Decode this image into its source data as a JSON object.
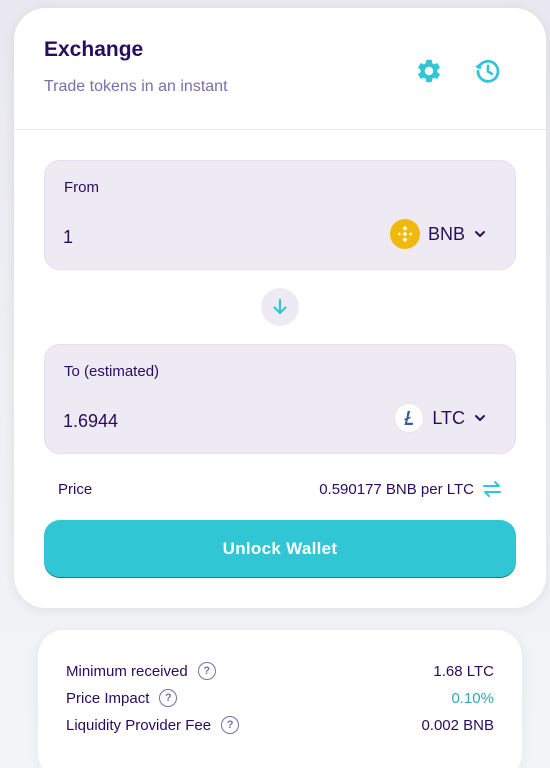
{
  "header": {
    "title": "Exchange",
    "subtitle": "Trade tokens in an instant",
    "settings_icon": "gear-icon",
    "history_icon": "history-icon"
  },
  "from": {
    "label": "From",
    "amount": "1",
    "token": "BNB",
    "token_icon": "bnb-logo-icon"
  },
  "to": {
    "label": "To (estimated)",
    "amount": "1.6944",
    "token": "LTC",
    "token_icon": "ltc-logo-icon"
  },
  "swap_icon": "arrow-down-icon",
  "price": {
    "label": "Price",
    "value": "0.590177 BNB per LTC",
    "switch_icon": "swap-arrows-icon"
  },
  "action": {
    "label": "Unlock Wallet"
  },
  "details": {
    "minimum_received": {
      "label": "Minimum received",
      "value": "1.68 LTC"
    },
    "price_impact": {
      "label": "Price Impact",
      "value": "0.10%"
    },
    "lp_fee": {
      "label": "Liquidity Provider Fee",
      "value": "0.002 BNB"
    }
  },
  "colors": {
    "primary": "#31c6d3",
    "text": "#280d5f",
    "subtext": "#7a6eaa",
    "input_bg": "#eeeaf4",
    "impact": "#31a6b8",
    "bnb": "#f0b90b"
  }
}
